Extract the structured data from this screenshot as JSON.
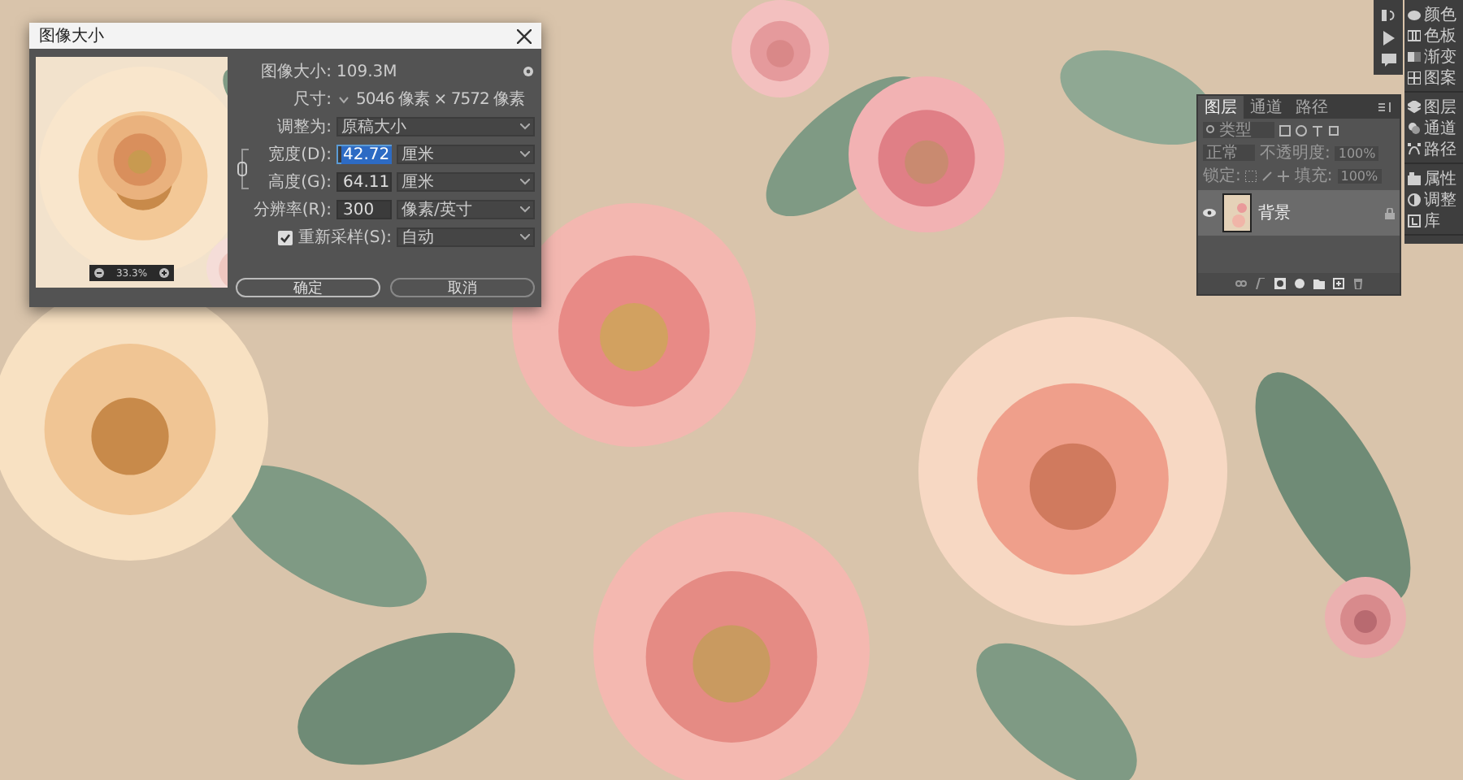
{
  "dialog": {
    "title": "图像大小",
    "image_size_label": "图像大小:",
    "image_size_value": "109.3M",
    "dimensions_label": "尺寸:",
    "dimensions_value": "5046 像素 × 7572 像素",
    "fit_label": "调整为:",
    "fit_value": "原稿大小",
    "fields": [
      {
        "label": "宽度(D):",
        "value": "42.72",
        "unit": "厘米",
        "selected": true
      },
      {
        "label": "高度(G):",
        "value": "64.11",
        "unit": "厘米",
        "selected": false
      },
      {
        "label": "分辨率(R):",
        "value": "300",
        "unit": "像素/英寸",
        "selected": false
      }
    ],
    "resample": {
      "label": "重新采样(S):",
      "checked": true,
      "value": "自动"
    },
    "preview_zoom": "33.3%",
    "buttons": [
      {
        "label": "确定",
        "kind": "primary"
      },
      {
        "label": "取消",
        "kind": "secondary"
      }
    ]
  },
  "layers_panel": {
    "tabs": [
      {
        "label": "图层",
        "selected": true
      },
      {
        "label": "通道",
        "selected": false
      },
      {
        "label": "路径",
        "selected": false
      }
    ],
    "search_placeholder": "类型",
    "blend_mode": "正常",
    "opacity_label": "不透明度:",
    "opacity_value": "100%",
    "lock_label": "锁定:",
    "fill_label": "填充:",
    "fill_value": "100%",
    "layers": [
      {
        "name": "背景",
        "visible": true,
        "selected": true,
        "locked": true
      }
    ]
  },
  "dock": {
    "groups": [
      [
        {
          "label": "颜色"
        },
        {
          "label": "色板"
        },
        {
          "label": "渐变"
        },
        {
          "label": "图案"
        }
      ],
      [
        {
          "label": "图层"
        },
        {
          "label": "通道"
        },
        {
          "label": "路径"
        }
      ],
      [
        {
          "label": "属性"
        },
        {
          "label": "调整"
        },
        {
          "label": "库"
        }
      ]
    ]
  }
}
